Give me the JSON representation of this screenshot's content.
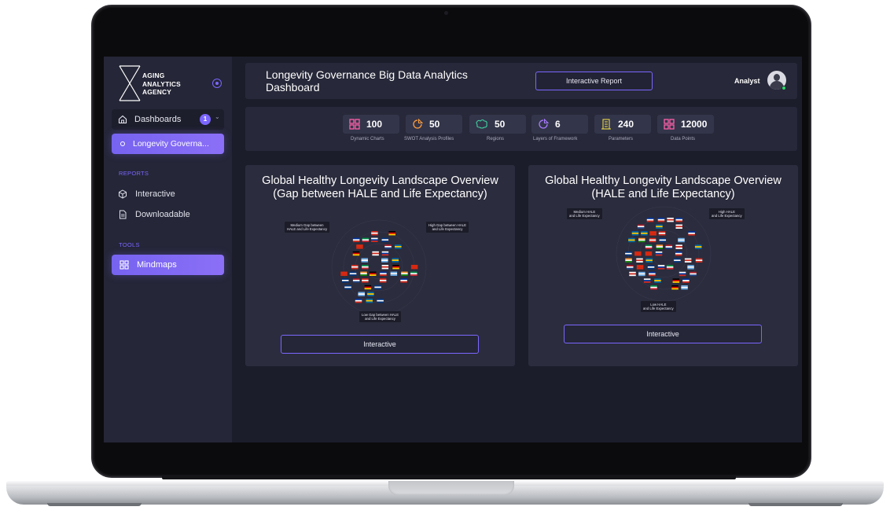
{
  "brand": {
    "lines": [
      "AGING",
      "ANALYTICS",
      "AGENCY"
    ]
  },
  "sidebar": {
    "dashboards_label": "Dashboards",
    "dashboards_count": "1",
    "active_item": "Longevity Governa...",
    "reports_heading": "REPORTS",
    "reports": [
      "Interactive",
      "Downloadable"
    ],
    "tools_heading": "TOOLS",
    "tools": [
      "Mindmaps"
    ]
  },
  "header": {
    "title": "Longevity Governance Big Data Analytics Dashboard",
    "report_button": "Interactive Report",
    "user": "Analyst"
  },
  "stats": [
    {
      "value": "100",
      "caption": "Dynamic Charts",
      "icon": "grid-icon",
      "color": "#ff5fa8"
    },
    {
      "value": "50",
      "caption": "SWOT Analysis Profiles",
      "icon": "pie-icon",
      "color": "#ff9d3c"
    },
    {
      "value": "50",
      "caption": "Regions",
      "icon": "map-icon",
      "color": "#3fd1a0"
    },
    {
      "value": "6",
      "caption": "Layers of Framework",
      "icon": "layers-icon",
      "color": "#a77bff"
    },
    {
      "value": "240",
      "caption": "Parameters",
      "icon": "building-icon",
      "color": "#e7d84a"
    },
    {
      "value": "12000",
      "caption": "Data Points",
      "icon": "grid-icon",
      "color": "#ff5fa8"
    }
  ],
  "cards": [
    {
      "title": "Global Healthy Longevity Landscape Overview (Gap between HALE and Life Expectancy)",
      "tags": [
        "Medium Gap between",
        "HALE and Life Expectancy",
        "High Gap between HALE",
        "and Life Expectancy",
        "Low Gap between HALE",
        "and Life Expectancy"
      ],
      "button": "Interactive"
    },
    {
      "title": "Global Healthy Longevity Landscape Overview (HALE and Life Expectancy)",
      "tags": [
        "Medium HALE",
        "and Life Expectancy",
        "High HALE",
        "and Life Expectancy",
        "Low HALE",
        "and Life Expectancy"
      ],
      "button": "Interactive"
    }
  ]
}
